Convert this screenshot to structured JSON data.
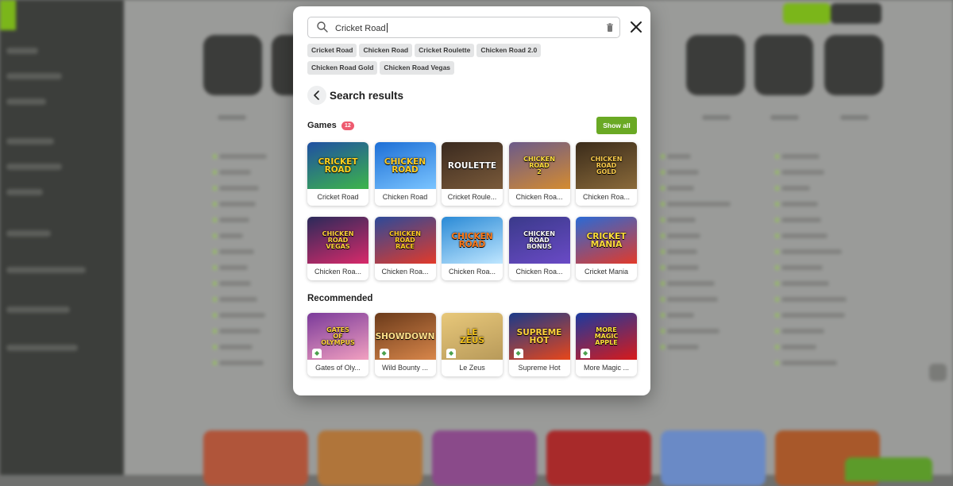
{
  "search": {
    "query": "Cricket Road",
    "suggestions": [
      "Cricket Road",
      "Chicken Road",
      "Cricket Roulette",
      "Chicken Road 2.0",
      "Chicken Road Gold",
      "Chicken Road Vegas"
    ]
  },
  "results": {
    "title": "Search results",
    "games_label": "Games",
    "games_count": "12",
    "show_all_label": "Show all",
    "games": [
      {
        "title": "Cricket Road",
        "art": "CRICKET ROAD",
        "bg": [
          "#1f4fa3",
          "#3db54a"
        ],
        "fg": "#ffd21f"
      },
      {
        "title": "Chicken Road",
        "art": "CHICKEN ROAD",
        "bg": [
          "#1d6fd6",
          "#7ac4ff"
        ],
        "fg": "#ffcc22"
      },
      {
        "title": "Cricket Roule...",
        "art": "ROULETTE",
        "bg": [
          "#3a2a1f",
          "#7a5a3a"
        ],
        "fg": "#ffffff"
      },
      {
        "title": "Chicken Roa...",
        "art": "CHICKEN ROAD 2",
        "bg": [
          "#6b5a8a",
          "#d48b30"
        ],
        "fg": "#ffde3a"
      },
      {
        "title": "Chicken Roa...",
        "art": "CHICKEN ROAD GOLD",
        "bg": [
          "#3a2b1a",
          "#8a6a3a"
        ],
        "fg": "#f7c94a"
      },
      {
        "title": "Chicken Roa...",
        "art": "CHICKEN ROAD VEGAS",
        "bg": [
          "#2a2a5a",
          "#d82a6a"
        ],
        "fg": "#ffd23a"
      },
      {
        "title": "Chicken Roa...",
        "art": "CHICKEN ROAD RACE",
        "bg": [
          "#2c4a9a",
          "#e23a2a"
        ],
        "fg": "#ffcc22"
      },
      {
        "title": "Chicken Roa...",
        "art": "CHICKEN ROAD",
        "bg": [
          "#2a8ad6",
          "#bfe6ff"
        ],
        "fg": "#ff7a1a"
      },
      {
        "title": "Chicken Roa...",
        "art": "CHICKEN ROAD BONUS",
        "bg": [
          "#3a3a8a",
          "#6a4ac6"
        ],
        "fg": "#ffffff"
      },
      {
        "title": "Cricket Mania",
        "art": "CRICKET MANIA",
        "bg": [
          "#2a6ad6",
          "#e23a2a"
        ],
        "fg": "#ffde3a"
      }
    ],
    "recommended_label": "Recommended",
    "recommended": [
      {
        "title": "Gates of Oly...",
        "art": "GATES OF OLYMPUS",
        "bg": [
          "#7a3a9a",
          "#f2a0c0"
        ],
        "fg": "#ffd23a"
      },
      {
        "title": "Wild Bounty ...",
        "art": "SHOWDOWN",
        "bg": [
          "#6a3a1a",
          "#d8864a"
        ],
        "fg": "#ffe08a"
      },
      {
        "title": "Le Zeus",
        "art": "LE ZEUS",
        "bg": [
          "#e8c87a",
          "#b89a5a"
        ],
        "fg": "#f4c21a"
      },
      {
        "title": "Supreme Hot",
        "art": "SUPREME HOT",
        "bg": [
          "#1a3a8a",
          "#e8461a"
        ],
        "fg": "#ffd23a"
      },
      {
        "title": "More Magic ...",
        "art": "MORE MAGIC APPLE",
        "bg": [
          "#1a3aa0",
          "#d81a1a"
        ],
        "fg": "#ffe03a"
      }
    ]
  },
  "colors": {
    "accent": "#6aa924",
    "badge": "#ee5a6f"
  }
}
